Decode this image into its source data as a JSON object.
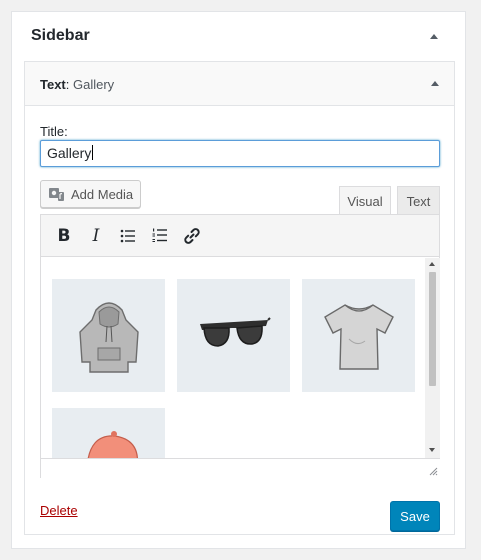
{
  "sidebar": {
    "title": "Sidebar"
  },
  "widget": {
    "type_label": "Text",
    "separator": ":",
    "instance_title": " Gallery",
    "title_label": "Title:",
    "title_value": "Gallery",
    "add_media_label": "Add Media",
    "tabs": {
      "visual": "Visual",
      "text": "Text"
    },
    "gallery_items": [
      "hoodie",
      "sunglasses",
      "t-shirt",
      "cap"
    ],
    "delete_label": "Delete",
    "save_label": "Save"
  },
  "colors": {
    "accent": "#0085ba",
    "delete": "#aa0000",
    "thumb_bg": "#e8edf1"
  },
  "icons": [
    "collapse-arrow-icon",
    "media-icon",
    "bold-icon",
    "italic-icon",
    "bullet-list-icon",
    "numbered-list-icon",
    "link-icon",
    "resize-handle-icon"
  ]
}
